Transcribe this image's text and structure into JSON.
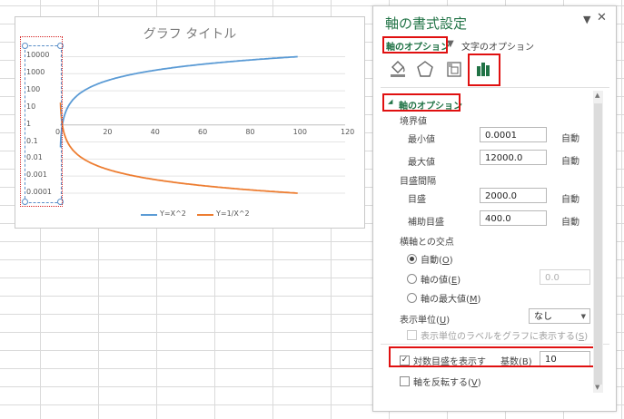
{
  "chart": {
    "title": "グラフ タイトル",
    "y_ticks": [
      "10000",
      "1000",
      "100",
      "10",
      "1",
      "0.1",
      "0.01",
      "0.001",
      "0.0001"
    ],
    "x_ticks": [
      "0",
      "20",
      "40",
      "60",
      "80",
      "100",
      "120"
    ],
    "legend": [
      "Y=X^2",
      "Y=1/X^2"
    ],
    "colors": {
      "series1": "#5b9bd5",
      "series2": "#ed7d31"
    }
  },
  "chart_data": {
    "type": "line",
    "title": "グラフ タイトル",
    "x": [
      0.2,
      1,
      5,
      10,
      20,
      30,
      40,
      50,
      60,
      70,
      80,
      90,
      100
    ],
    "series": [
      {
        "name": "Y=X^2",
        "values": [
          0.04,
          1,
          25,
          100,
          400,
          900,
          1600,
          2500,
          3600,
          4900,
          6400,
          8100,
          10000
        ]
      },
      {
        "name": "Y=1/X^2",
        "values": [
          25,
          1,
          0.04,
          0.01,
          0.0025,
          0.00111,
          0.000625,
          0.0004,
          0.000278,
          0.000204,
          0.000156,
          0.000123,
          0.0001
        ]
      }
    ],
    "xlim": [
      0,
      120
    ],
    "ylim": [
      0.0001,
      12000
    ],
    "yscale": "log",
    "grid": true,
    "legend_position": "bottom"
  },
  "pane": {
    "title": "軸の書式設定",
    "dropdown_icon": "dropdown-arrow",
    "close_icon": "close",
    "tab_axis": "軸のオプション",
    "tab_text": "文字のオプション",
    "section_title": "軸のオプション",
    "bounds": "境界値",
    "min_label": "最小値",
    "min_value": "0.0001",
    "max_label": "最大値",
    "max_value": "12000.0",
    "auto": "自動",
    "units": "目盛間隔",
    "major_label": "目盛",
    "major_value": "2000.0",
    "minor_label": "補助目盛",
    "minor_value": "400.0",
    "crosses": "横軸との交点",
    "radio_auto": "自動(",
    "radio_auto_key": "O",
    "radio_value": "軸の値(",
    "radio_value_key": "E",
    "axis_value": "0.0",
    "radio_max": "軸の最大値(",
    "radio_max_key": "M",
    "display_units_label": "表示単位(",
    "display_units_key": "U",
    "display_units_value": "なし",
    "show_units_label": "表示単位のラベルをグラフに表示する(",
    "show_units_key": "S",
    "log_label": "対数目盛を表示す",
    "base_label": "基数(",
    "base_key": "B",
    "base_value": "10",
    "reverse_label": "軸を反転する(",
    "reverse_key": "V",
    "close_paren": ")",
    "check_mark": "✓",
    "dropdown_arrow": "▼"
  }
}
